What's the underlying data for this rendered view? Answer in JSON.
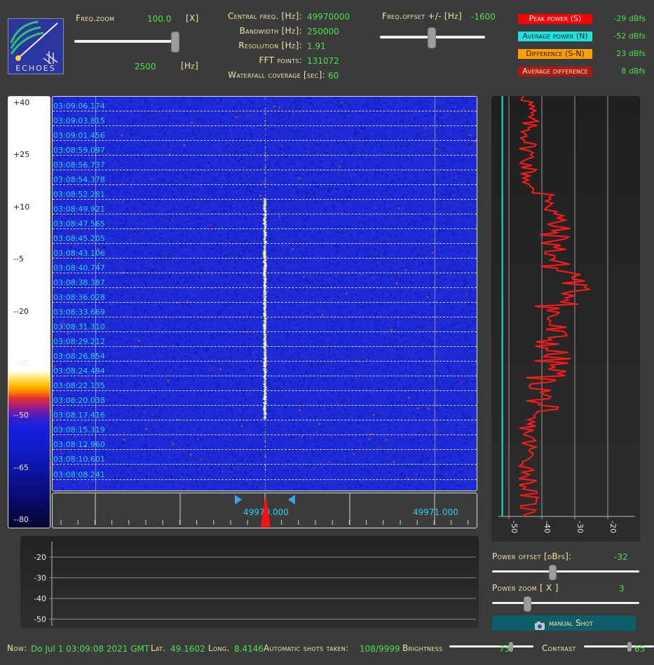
{
  "header": {
    "freq_zoom_label": "Freq.zoom",
    "freq_zoom_value": "100.0",
    "freq_zoom_unit": "[X]",
    "freq_span_value": "2500",
    "freq_span_unit": "[Hz]",
    "central_freq_label": "Central freq. [Hz]:",
    "central_freq_value": "49970000",
    "bandwidth_label": "Bandwidth [Hz]:",
    "bandwidth_value": "250000",
    "resolution_label": "Resolution [Hz]:",
    "resolution_value": "1.91",
    "fft_points_label": "FFT points:",
    "fft_points_value": "131072",
    "waterfall_coverage_label": "Waterfall coverage [sec]:",
    "waterfall_coverage_value": "60",
    "freq_offset_label": "Freq.offset +/- [Hz]",
    "freq_offset_value": "-1600",
    "freq_zoom_slider_level": 0.97,
    "freq_offset_slider_level": 0.49
  },
  "logo": {
    "text": "ECHOES"
  },
  "legend": [
    {
      "label": "Peak power (S)",
      "value": "-29 dBfs",
      "bg": "#ff0000",
      "fg": "#ffffff"
    },
    {
      "label": "Average power (N)",
      "value": "-52 dBfs",
      "bg": "#18e4e4",
      "fg": "#1a1a1a"
    },
    {
      "label": "Difference (S-N)",
      "value": "23 dBfs",
      "bg": "#ff9e00",
      "fg": "#1a1a1a"
    },
    {
      "label": "Average difference",
      "value": "8 dBfs",
      "bg": "#b01818",
      "fg": "#f2e7a6"
    }
  ],
  "colorbar": {
    "ticks": [
      "+40",
      "+25",
      "+10",
      "--5",
      "--20",
      "--35",
      "--50",
      "--65",
      "--80"
    ]
  },
  "waterfall": {
    "timestamps": [
      "03:09:06.174",
      "03:09:03.815",
      "03:09:01.456",
      "03:08:59.097",
      "03:08:56.737",
      "03:08:54.378",
      "03:08:52.281",
      "03:08:49.921",
      "03:08:47.565",
      "03:08:45.205",
      "03:08:43.106",
      "03:08:40.747",
      "03:08:38.387",
      "03:08:36.028",
      "03:08:33.669",
      "03:08:31.310",
      "03:08:29.212",
      "03:08:26.854",
      "03:08:24.494",
      "03:08:22.135",
      "03:08:20.038",
      "03:08:17.416",
      "03:08:15.319",
      "03:08:12.960",
      "03:08:10.601",
      "03:08:08.241"
    ]
  },
  "freq_axis": {
    "label_1": "49970.000",
    "label_2": "49971.000"
  },
  "power_chart": {
    "ticks": [
      "-50",
      "-40",
      "-30",
      "-20"
    ],
    "avg_power_dbfs": -52
  },
  "bottom_chart": {
    "ticks": [
      "-20",
      "-30",
      "-40",
      "-50"
    ]
  },
  "controls": {
    "power_offset_label": "Power offset [dBfs]:",
    "power_offset_value": "-32",
    "power_zoom_label": "Power zoom  [ X ]",
    "power_zoom_value": "3",
    "manual_shot_label": "manual Shot",
    "power_offset_slider_level": 0.41,
    "power_zoom_slider_level": 0.24
  },
  "status": {
    "now_label": "Now:",
    "now_value": "Do Jul 1 03:09:08 2021 GMT",
    "lat_label": "Lat.",
    "lat_value": "49.1602",
    "long_label": "Long.",
    "long_value": "8.4146",
    "shots_label": "Automatic shots taken:",
    "shots_value": "108/9999",
    "brightness_label": "Brightness",
    "brightness_value": "73",
    "contrast_label": "Contrast",
    "contrast_value": "65",
    "brightness_slider_level": 0.73,
    "contrast_slider_level": 0.65
  }
}
